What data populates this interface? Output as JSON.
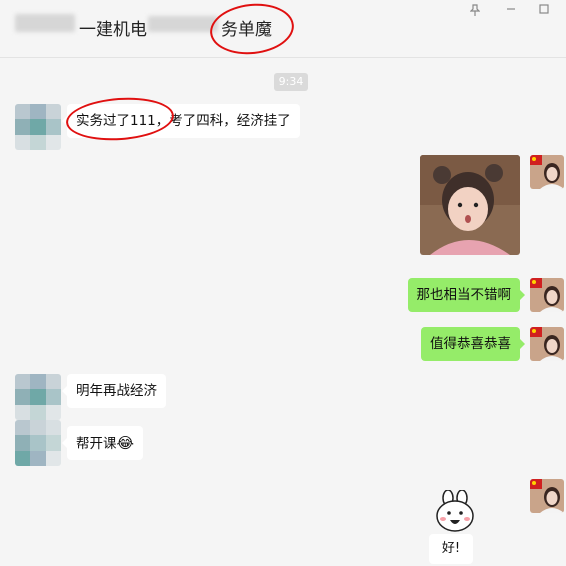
{
  "header": {
    "title_part1": "一建机电",
    "title_part2": "务单魔",
    "pin_icon": "pin-icon",
    "minimize_icon": "minimize-icon",
    "maximize_icon": "maximize-icon"
  },
  "chat": {
    "timestamp": "9:34",
    "messages": [
      {
        "side": "left",
        "text": "实务过了111，考了四科，经济挂了"
      },
      {
        "side": "right",
        "type": "image",
        "description_icon": "child-photo"
      },
      {
        "side": "right",
        "text": "那也相当不错啊"
      },
      {
        "side": "right",
        "text": "值得恭喜恭喜"
      },
      {
        "side": "left",
        "text": "明年再战经济"
      },
      {
        "side": "left",
        "text": "帮开课",
        "emoji": "😂"
      },
      {
        "side": "right",
        "type": "sticker",
        "text": "好!"
      }
    ]
  },
  "colors": {
    "accent_red": "#e01010",
    "bubble_out": "#95ec69",
    "bubble_in": "#ffffff",
    "background": "#f5f5f5"
  }
}
